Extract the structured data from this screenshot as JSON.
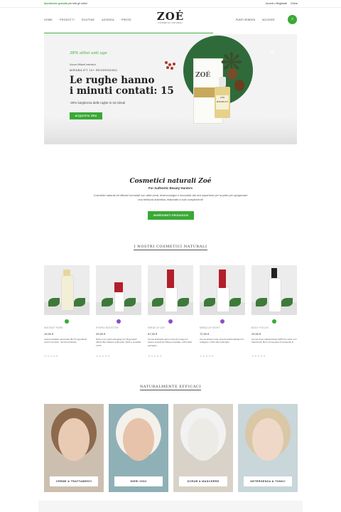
{
  "topbar": {
    "promo_bold": "Spedizione gratuita",
    "promo_rest": "per tutti gli ordini",
    "login": "Accedi o Registrati",
    "lang": "Ghina"
  },
  "nav": {
    "left": [
      "HOME",
      "PRODOTTI",
      "ROUTINE",
      "AZIENDA",
      "PRESS"
    ],
    "right": [
      "PUNTI VENDITA",
      "ACCOUNT"
    ]
  },
  "logo": {
    "mark": "ZOÉ",
    "sub": "COSMETICI NATURALI"
  },
  "hero": {
    "tag": "38% attivi anti age",
    "small1": "Nuovo lifftanti intensivo",
    "small2": "MIRABILIFT 10+ REVERSKINO",
    "title_line1": "Le rughe hanno",
    "title_line2": "i minuti contati: 15",
    "desc": "-20% lunghezza delle rughe in 15 minuti",
    "cta": "ACQUISTA ORA",
    "box_name": "ZOÉ",
    "bottle_label": "ZOÉ MIRABILIFT"
  },
  "intro": {
    "title": "Cosmetici naturali Zoé",
    "subtitle": "For Authentic Beauty Hunters",
    "text": "Cosmetici naturali ed efficaci formulati con attivi verdi, biotecnologici e innovativi dai veri superfood per la pelle per sprigionare una bellezza autentica, elaborate a solo complimenti!",
    "cta": "INGREDIENTI PRODIGIOSI"
  },
  "section1": {
    "title": "I NOSTRI COSMETICI NATURALI"
  },
  "products": [
    {
      "name": "INSTANT PURE",
      "price": "19,90 €",
      "text": "Acqua micellare struccante 99,7% ingredienti verdi in formula · Senza risciacquo",
      "dot": "#3aa935",
      "cap": "#e8d6a0"
    },
    {
      "name": "HYDRO BOOSTER",
      "price": "29,90 €",
      "text": "Dirimo con pochi anti-aging con Ring-Age® effetto filler efficace sulla pelle | 93% e sensibile | 97%",
      "dot": "#8a4fc2",
      "cap": "#b21f2a"
    },
    {
      "name": "MIRACLE DAY",
      "price": "67,90 €",
      "text": "Crema antirughe giorno ricca di omega 3 e azione tensiva bio lifting immediato +14% attivi antirughe",
      "dot": "#8a4fc2",
      "cap": "#b21f2a"
    },
    {
      "name": "MIRACLE NIGHT",
      "price": "72,90 €",
      "text": "Crema antiete notte ricca di peptidi attivatori di collagene +10% attivi antirughe",
      "dot": "#8a4fc2",
      "cap": "#b21f2a"
    },
    {
      "name": "BODY FOCUS",
      "price": "29,90 €",
      "text": "Crema corpo elasticizzante 100% bio verde con Vitamina E, Burro di Cupuacu & Ceramide N",
      "dot": "#3aa935",
      "cap": "#222222"
    }
  ],
  "section2": {
    "title": "NATURALMENTE EFFICACI"
  },
  "categories": [
    {
      "label": "CREME & TRATTAMENTI",
      "bg": "#cdbfb0"
    },
    {
      "label": "SIERI VISO",
      "bg": "#8fb0b6"
    },
    {
      "label": "SCRUB & MASCHERE",
      "bg": "#d8d2c8"
    },
    {
      "label": "DETERGENZA & TONICI",
      "bg": "#c9d6da"
    }
  ],
  "colors": {
    "accent": "#3aa935"
  }
}
